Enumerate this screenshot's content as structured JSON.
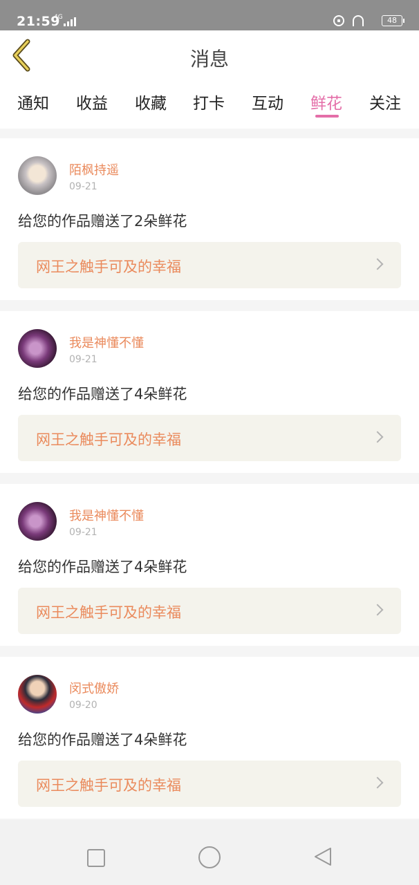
{
  "status_bar": {
    "time": "21:59",
    "network": "4G",
    "battery": "48"
  },
  "header": {
    "title": "消息",
    "back_icon": "chevron-left-icon"
  },
  "tabs": [
    {
      "label": "通知",
      "active": false
    },
    {
      "label": "收益",
      "active": false
    },
    {
      "label": "收藏",
      "active": false
    },
    {
      "label": "打卡",
      "active": false
    },
    {
      "label": "互动",
      "active": false
    },
    {
      "label": "鲜花",
      "active": true
    },
    {
      "label": "关注",
      "active": false
    }
  ],
  "messages": [
    {
      "user": "陌枫持遥",
      "date": "09-21",
      "text": "给您的作品赠送了2朵鲜花",
      "work": "网王之触手可及的幸福"
    },
    {
      "user": "我是神懂不懂",
      "date": "09-21",
      "text": "给您的作品赠送了4朵鲜花",
      "work": "网王之触手可及的幸福"
    },
    {
      "user": "我是神懂不懂",
      "date": "09-21",
      "text": "给您的作品赠送了4朵鲜花",
      "work": "网王之触手可及的幸福"
    },
    {
      "user": "闵式傲娇",
      "date": "09-20",
      "text": "给您的作品赠送了4朵鲜花",
      "work": "网王之触手可及的幸福"
    }
  ],
  "colors": {
    "accent": "#e46ea8",
    "username": "#ea8a5c",
    "link_bg": "#f4f3ec"
  },
  "navbar": {
    "icons": [
      "recent-apps-icon",
      "home-icon",
      "back-icon"
    ]
  }
}
